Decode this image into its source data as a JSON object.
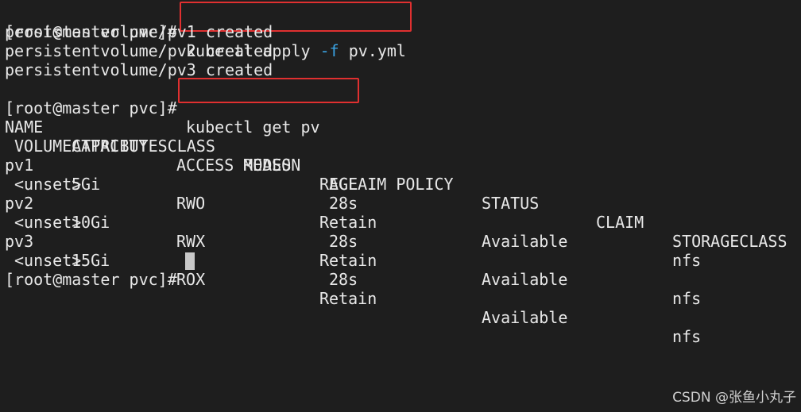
{
  "terminal": {
    "prompt": "[root@master pvc]# ",
    "cmd1": {
      "base": "kubectl apply ",
      "flag": "-f",
      "arg": " pv.yml"
    },
    "output_created": [
      "persistentvolume/pv1 created",
      "persistentvolume/pv2 created",
      "persistentvolume/pv3 created"
    ],
    "cmd2": "kubectl get pv",
    "table": {
      "headers": [
        "NAME",
        "CAPACITY",
        "ACCESS MODES",
        "RECLAIM POLICY",
        "STATUS",
        "CLAIM",
        "STORAGECLASS"
      ],
      "headers_wrap": [
        "VOLUMEATTRIBUTESCLASS",
        "REASON",
        "AGE"
      ],
      "rows": [
        {
          "name": "pv1",
          "capacity": "5Gi",
          "access": "RWO",
          "reclaim": "Retain",
          "status": "Available",
          "storageclass": "nfs",
          "vac": "<unset>",
          "age": "28s"
        },
        {
          "name": "pv2",
          "capacity": "10Gi",
          "access": "RWX",
          "reclaim": "Retain",
          "status": "Available",
          "storageclass": "nfs",
          "vac": "<unset>",
          "age": "28s"
        },
        {
          "name": "pv3",
          "capacity": "15Gi",
          "access": "ROX",
          "reclaim": "Retain",
          "status": "Available",
          "storageclass": "nfs",
          "vac": "<unset>",
          "age": "28s"
        }
      ]
    }
  },
  "watermark": "CSDN @张鱼小丸子",
  "colors": {
    "background": "#1e1e1e",
    "text": "#e8e8e8",
    "flag": "#3aa3e3",
    "highlight": "#e03030",
    "cursor": "#c8c8c8"
  }
}
